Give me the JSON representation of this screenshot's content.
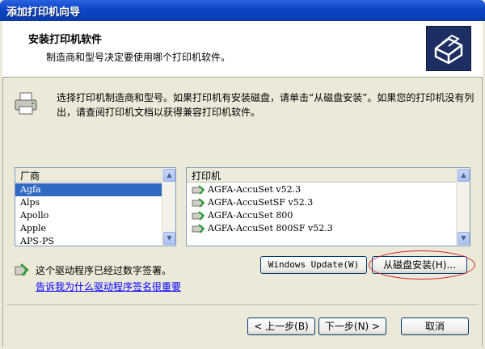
{
  "window": {
    "title": "添加打印机向导"
  },
  "header": {
    "title": "安装打印机软件",
    "subtitle": "制造商和型号决定要使用哪个打印机软件。"
  },
  "instruction": "选择打印机制造商和型号。如果打印机有安装磁盘，请单击“从磁盘安装”。如果您的打印机没有列出，请查阅打印机文档以获得兼容打印机软件。",
  "manufacturers": {
    "header": "厂商",
    "selected_index": 0,
    "items": [
      "Agfa",
      "Alps",
      "Apollo",
      "Apple",
      "APS-PS"
    ]
  },
  "printers": {
    "header": "打印机",
    "items": [
      "AGFA-AccuSet v52.3",
      "AGFA-AccuSetSF v52.3",
      "AGFA-AccuSet 800",
      "AGFA-AccuSet 800SF v52.3"
    ]
  },
  "driver_signed": "这个驱动程序已经过数字签署。",
  "signing_link": "告诉我为什么驱动程序签名很重要",
  "buttons": {
    "windows_update": "Windows Update(W)",
    "have_disk": "从磁盘安装(H)...",
    "back": "< 上一步(B)",
    "next": "下一步(N) >",
    "cancel": "取消"
  },
  "colors": {
    "titlebar": "#0a46c8",
    "selection": "#316ac5",
    "link": "#0000ff",
    "annotation": "#d42020"
  }
}
